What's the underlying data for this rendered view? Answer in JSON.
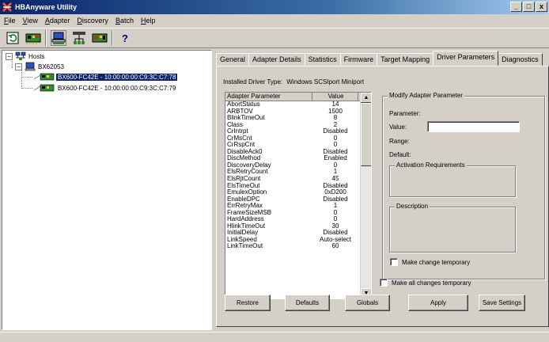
{
  "window": {
    "title": "HBAnyware Utility",
    "controls": [
      "_",
      "□",
      "x"
    ]
  },
  "menu": [
    {
      "label": "File",
      "u": "F",
      "rest": "ile"
    },
    {
      "label": "View",
      "u": "V",
      "rest": "iew"
    },
    {
      "label": "Adapter",
      "u": "A",
      "rest": "dapter"
    },
    {
      "label": "Discovery",
      "u": "D",
      "rest": "iscovery"
    },
    {
      "label": "Batch",
      "u": "B",
      "rest": "atch"
    },
    {
      "label": "Help",
      "u": "H",
      "rest": "elp"
    }
  ],
  "toolbar": {
    "help_glyph": "?"
  },
  "tree": {
    "root": "Hosts",
    "host": "BX62053",
    "adapters": [
      "BX600-FC42E - 10:00:00:00:C9:3C:C7:78",
      "BX600-FC42E - 10:00:00:00:C9:3C:C7:79"
    ]
  },
  "tabs": [
    "General",
    "Adapter Details",
    "Statistics",
    "Firmware",
    "Target Mapping",
    "Driver Parameters",
    "Diagnostics"
  ],
  "active_tab": "Driver Parameters",
  "driver": {
    "installed_label": "Installed Driver Type:",
    "installed_value": "Windows SCSIport Miniport"
  },
  "param_table": {
    "col_name": "Adapter Parameter",
    "col_value": "Value",
    "rows": [
      [
        "AbortStatus",
        "14"
      ],
      [
        "ARBTOV",
        "1500"
      ],
      [
        "BlinkTimeOut",
        "8"
      ],
      [
        "Class",
        "2"
      ],
      [
        "CrIntrpt",
        "Disabled"
      ],
      [
        "CrMsCnt",
        "0"
      ],
      [
        "CrRspCnt",
        "0"
      ],
      [
        "DisableAck0",
        "Disabled"
      ],
      [
        "DiscMethod",
        "Enabled"
      ],
      [
        "DiscoveryDelay",
        "0"
      ],
      [
        "ElsRetryCount",
        "1"
      ],
      [
        "ElsRjtCount",
        "45"
      ],
      [
        "ElsTimeOut",
        "Disabled"
      ],
      [
        "EmulexOption",
        "0xD200"
      ],
      [
        "EnableDPC",
        "Disabled"
      ],
      [
        "ErrRetryMax",
        "1"
      ],
      [
        "FrameSizeMSB",
        "0"
      ],
      [
        "HardAddress",
        "0"
      ],
      [
        "HlinkTimeOut",
        "30"
      ],
      [
        "InitialDelay",
        "Disabled"
      ],
      [
        "LinkSpeed",
        "Auto-select"
      ],
      [
        "LinkTimeOut",
        "60"
      ]
    ]
  },
  "modify": {
    "group_label": "Modify Adapter Parameter",
    "parameter_label": "Parameter:",
    "value_label": "Value:",
    "value_input": "",
    "range_label": "Range:",
    "default_label": "Default:",
    "activation_label": "Activation Requirements",
    "description_label": "Description",
    "temp_label": "Make change temporary"
  },
  "all_temp_label": "Make all changes temporary",
  "buttons": {
    "restore": "Restore",
    "defaults": "Defaults",
    "globals": "Globals",
    "apply": "Apply",
    "save": "Save Settings"
  }
}
